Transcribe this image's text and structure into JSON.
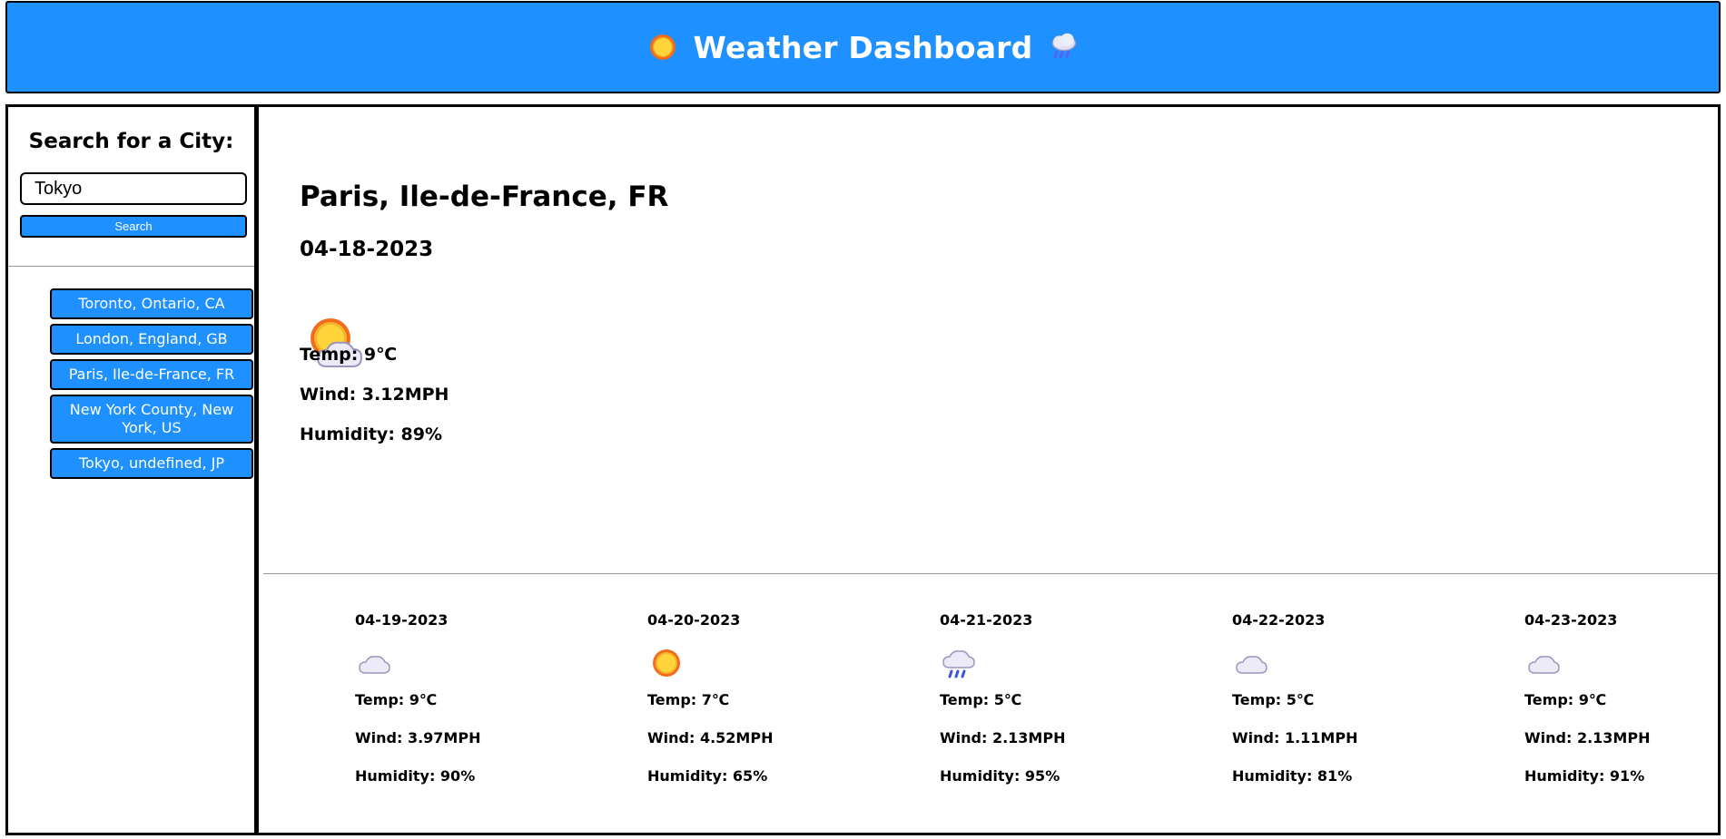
{
  "header": {
    "title": "Weather Dashboard",
    "left_icon": "sun-icon",
    "right_icon": "rain-cloud-icon",
    "background": "#1e90ff"
  },
  "sidebar": {
    "title": "Search for a City:",
    "search_value": "Tokyo",
    "search_button_label": "Search",
    "history": [
      "Toronto, Ontario, CA",
      "London, England, GB",
      "Paris, Ile-de-France, FR",
      "New York County, New York, US",
      "Tokyo, undefined, JP"
    ]
  },
  "current": {
    "city": "Paris, Ile-de-France, FR",
    "date": "04-18-2023",
    "icon": "partly-cloudy-icon",
    "temp": "Temp: 9℃",
    "wind": "Wind: 3.12MPH",
    "humidity": "Humidity: 89%"
  },
  "forecast": [
    {
      "date": "04-19-2023",
      "icon": "cloud-icon",
      "temp": "Temp: 9℃",
      "wind": "Wind: 3.97MPH",
      "humidity": "Humidity: 90%"
    },
    {
      "date": "04-20-2023",
      "icon": "sun-icon",
      "temp": "Temp: 7℃",
      "wind": "Wind: 4.52MPH",
      "humidity": "Humidity: 65%"
    },
    {
      "date": "04-21-2023",
      "icon": "rain-cloud-icon",
      "temp": "Temp: 5℃",
      "wind": "Wind: 2.13MPH",
      "humidity": "Humidity: 95%"
    },
    {
      "date": "04-22-2023",
      "icon": "cloud-icon",
      "temp": "Temp: 5℃",
      "wind": "Wind: 1.11MPH",
      "humidity": "Humidity: 81%"
    },
    {
      "date": "04-23-2023",
      "icon": "cloud-icon",
      "temp": "Temp: 9℃",
      "wind": "Wind: 2.13MPH",
      "humidity": "Humidity: 91%"
    }
  ]
}
